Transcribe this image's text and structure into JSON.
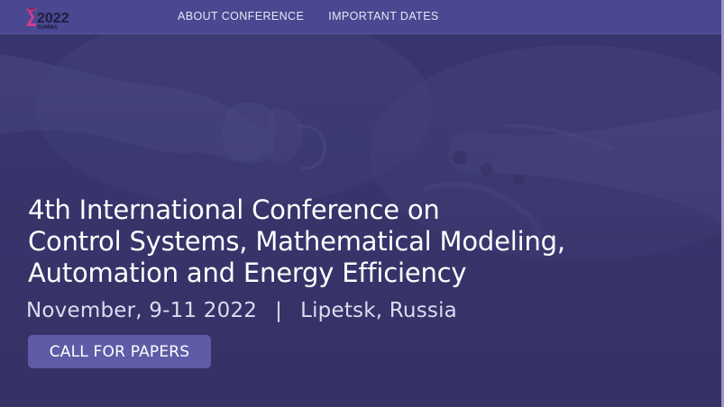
{
  "logo": {
    "text": "2022",
    "subtext": "SUMMA",
    "icon": "summa-logo-icon"
  },
  "nav": {
    "items": [
      {
        "label": "ABOUT CONFERENCE"
      },
      {
        "label": "IMPORTANT DATES"
      }
    ]
  },
  "hero": {
    "title_lines": [
      "4th International Conference on",
      "Control Systems, Mathematical Modeling,",
      "Automation and Energy Efficiency"
    ],
    "date": "November, 9-11 2022",
    "separator": "|",
    "location": "Lipetsk, Russia",
    "cta_label": "CALL FOR PAPERS",
    "background_image": "hand-and-robot-hand-photo"
  },
  "colors": {
    "overlay": "#353267",
    "nav_bar": "#4a4890",
    "cta": "#5e5ca6",
    "logo_accent": "#d43a8c"
  }
}
